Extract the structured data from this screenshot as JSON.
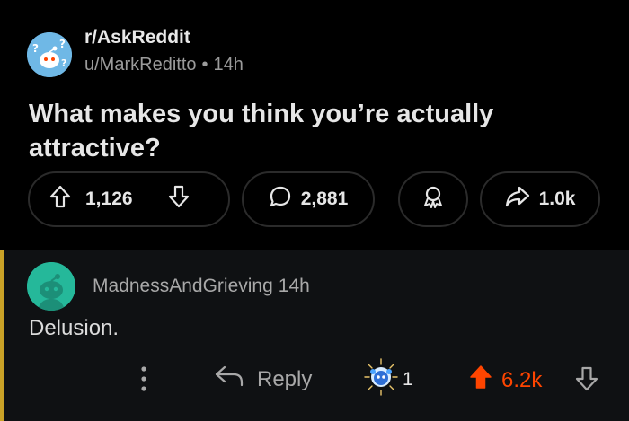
{
  "post": {
    "subreddit": "r/AskReddit",
    "author": "u/MarkReditto",
    "separator": "•",
    "age": "14h",
    "title": "What makes you think you’re actually attractive?",
    "upvotes": "1,126",
    "comments": "2,881",
    "shares": "1.0k",
    "icons": [
      "askreddit-avatar-icon",
      "upvote-arrow-icon",
      "downvote-arrow-icon",
      "comment-bubble-icon",
      "award-icon",
      "share-arrow-icon"
    ]
  },
  "comment": {
    "username": "MadnessAndGrieving",
    "age": "14h",
    "body": "Delusion.",
    "reply_label": "Reply",
    "award_count": "1",
    "score": "6.2k",
    "colors": {
      "upvoted": "#ff4500",
      "thread_bar": "#c9a227",
      "avatar_bg": "#25b89a"
    },
    "icons": [
      "more-vertical-icon",
      "reply-arrow-icon",
      "award-gift-icon",
      "upvote-filled-icon",
      "downvote-arrow-icon"
    ]
  }
}
